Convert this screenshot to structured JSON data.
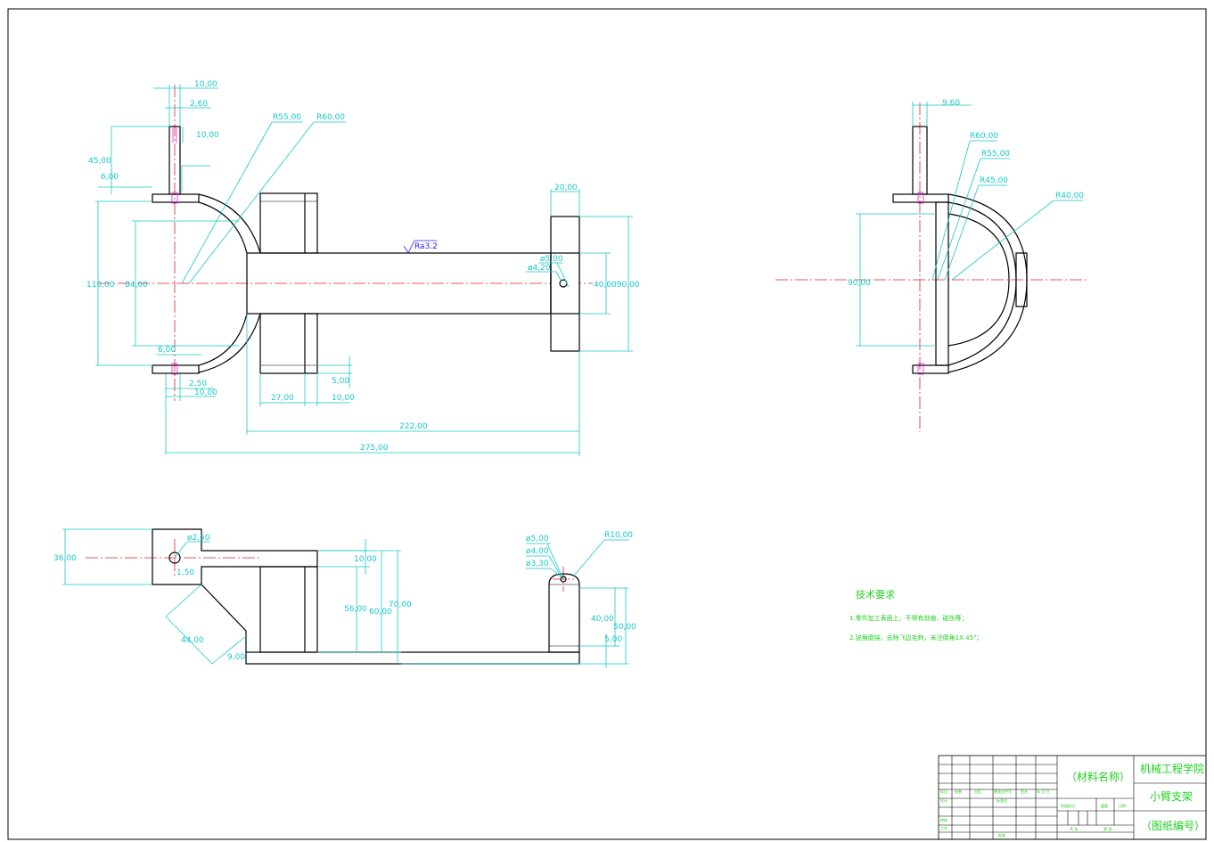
{
  "front_view": {
    "dims": {
      "d10_top": "10,00",
      "d2_60": "2,60",
      "d10_slot": "10,00",
      "d45": "45,00",
      "d6": "6,00",
      "r55": "R55,00",
      "r60": "R60,00",
      "d110": "110,00",
      "d84": "84,00",
      "d6_low": "6,00",
      "d2_50": "2,50",
      "d10_low": "10,00",
      "d27": "27,00",
      "d5": "5,00",
      "d10_right": "10,00",
      "d20": "20,00",
      "phi5": "ø5,00",
      "phi4_20": "ø4,20",
      "d40_90": "40,0090,00",
      "d222": "222,00",
      "d275": "275,00"
    },
    "roughness": "Ra3.2"
  },
  "side_view": {
    "dims": {
      "d9_60": "9,60",
      "r60": "R60,00",
      "r55": "R55,00",
      "r45": "R45,00",
      "r40": "R40,00",
      "d90": "90,00"
    }
  },
  "top_view": {
    "dims": {
      "d36": "36,00",
      "phi2_50": "ø2,50",
      "d1_50": "1,50",
      "d44": "44,00",
      "d9": "9,00",
      "d10": "10,00",
      "d56": "56,00",
      "d60": "60,00",
      "d70": "70,00",
      "phi5": "ø5,00",
      "phi4": "ø4,00",
      "phi3_30": "ø3,30",
      "r10": "R10,00",
      "d40": "40,00",
      "d50": "50,00",
      "d5": "5,00"
    }
  },
  "tech_requirements": {
    "title": "技术要求",
    "items": [
      "1.零件加工表面上，不得有划痕、碰伤等；",
      "2.锐角倒钝，去除飞边毛刺，未注倒角1X 45°；"
    ]
  },
  "title_block": {
    "material": "（材料名称）",
    "school": "机械工程学院",
    "part_name": "小臂支架",
    "drawing_no": "（图纸编号）",
    "small": [
      "标记",
      "处数",
      "分区",
      "更改文件号",
      "签名",
      "年 月 日",
      "设计",
      "标准化",
      "阶段标记",
      "重量",
      "比例",
      "审核",
      "工艺",
      "批准",
      "共 张",
      "第 张"
    ]
  }
}
